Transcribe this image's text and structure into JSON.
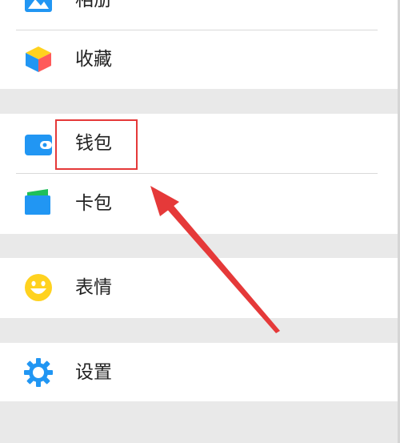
{
  "menu": {
    "album": {
      "label": "相册",
      "icon": "photo-album-icon"
    },
    "favorites": {
      "label": "收藏",
      "icon": "cube-favorites-icon"
    },
    "wallet": {
      "label": "钱包",
      "icon": "wallet-icon"
    },
    "card_pack": {
      "label": "卡包",
      "icon": "card-pack-icon"
    },
    "stickers": {
      "label": "表情",
      "icon": "smiley-icon"
    },
    "settings": {
      "label": "设置",
      "icon": "gear-icon"
    }
  },
  "colors": {
    "background": "#e9e9e9",
    "panel": "#ffffff",
    "accent_blue": "#2196f3",
    "highlight_red": "#e53939",
    "smiley_yellow": "#ffd21f",
    "card_green": "#1fbf5a"
  }
}
